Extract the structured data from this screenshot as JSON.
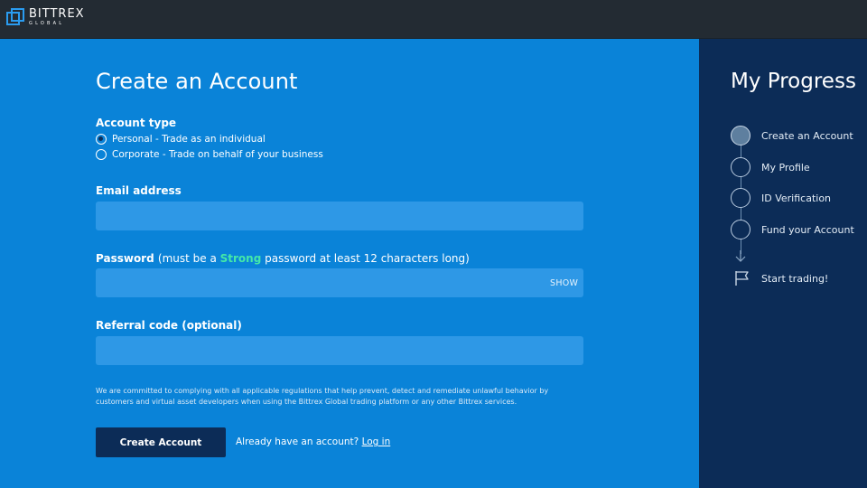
{
  "brand": {
    "name": "BITTREX",
    "sub": "GLOBAL"
  },
  "form": {
    "title": "Create an Account",
    "account_type_label": "Account type",
    "account_types": [
      {
        "label": "Personal - Trade as an individual",
        "selected": true
      },
      {
        "label": "Corporate - Trade on behalf of your business",
        "selected": false
      }
    ],
    "email_label": "Email address",
    "email_value": "",
    "password_label": "Password",
    "password_hint_pre": "(must be a ",
    "password_hint_strong": "Strong",
    "password_hint_post": " password at least 12 characters long)",
    "password_value": "",
    "show_label": "SHOW",
    "referral_label": "Referral code (optional)",
    "referral_value": "",
    "disclaimer": "We are committed to complying with all applicable regulations that help prevent, detect and remediate unlawful behavior by customers and virtual asset developers when using the Bittrex Global trading platform or any other Bittrex services.",
    "submit_label": "Create Account",
    "login_prompt": "Already have an account? ",
    "login_link": "Log in"
  },
  "progress": {
    "title": "My Progress",
    "steps": [
      {
        "label": "Create an Account",
        "active": true
      },
      {
        "label": "My Profile",
        "active": false
      },
      {
        "label": "ID Verification",
        "active": false
      },
      {
        "label": "Fund your Account",
        "active": false
      }
    ],
    "final_step": "Start trading!"
  },
  "colors": {
    "topbar": "#232b33",
    "main_bg": "#0a83d8",
    "input_bg": "#2e98e6",
    "sidebar_bg": "#0c2c57",
    "button_bg": "#0c2c57",
    "strong_text": "#44e8a8"
  }
}
